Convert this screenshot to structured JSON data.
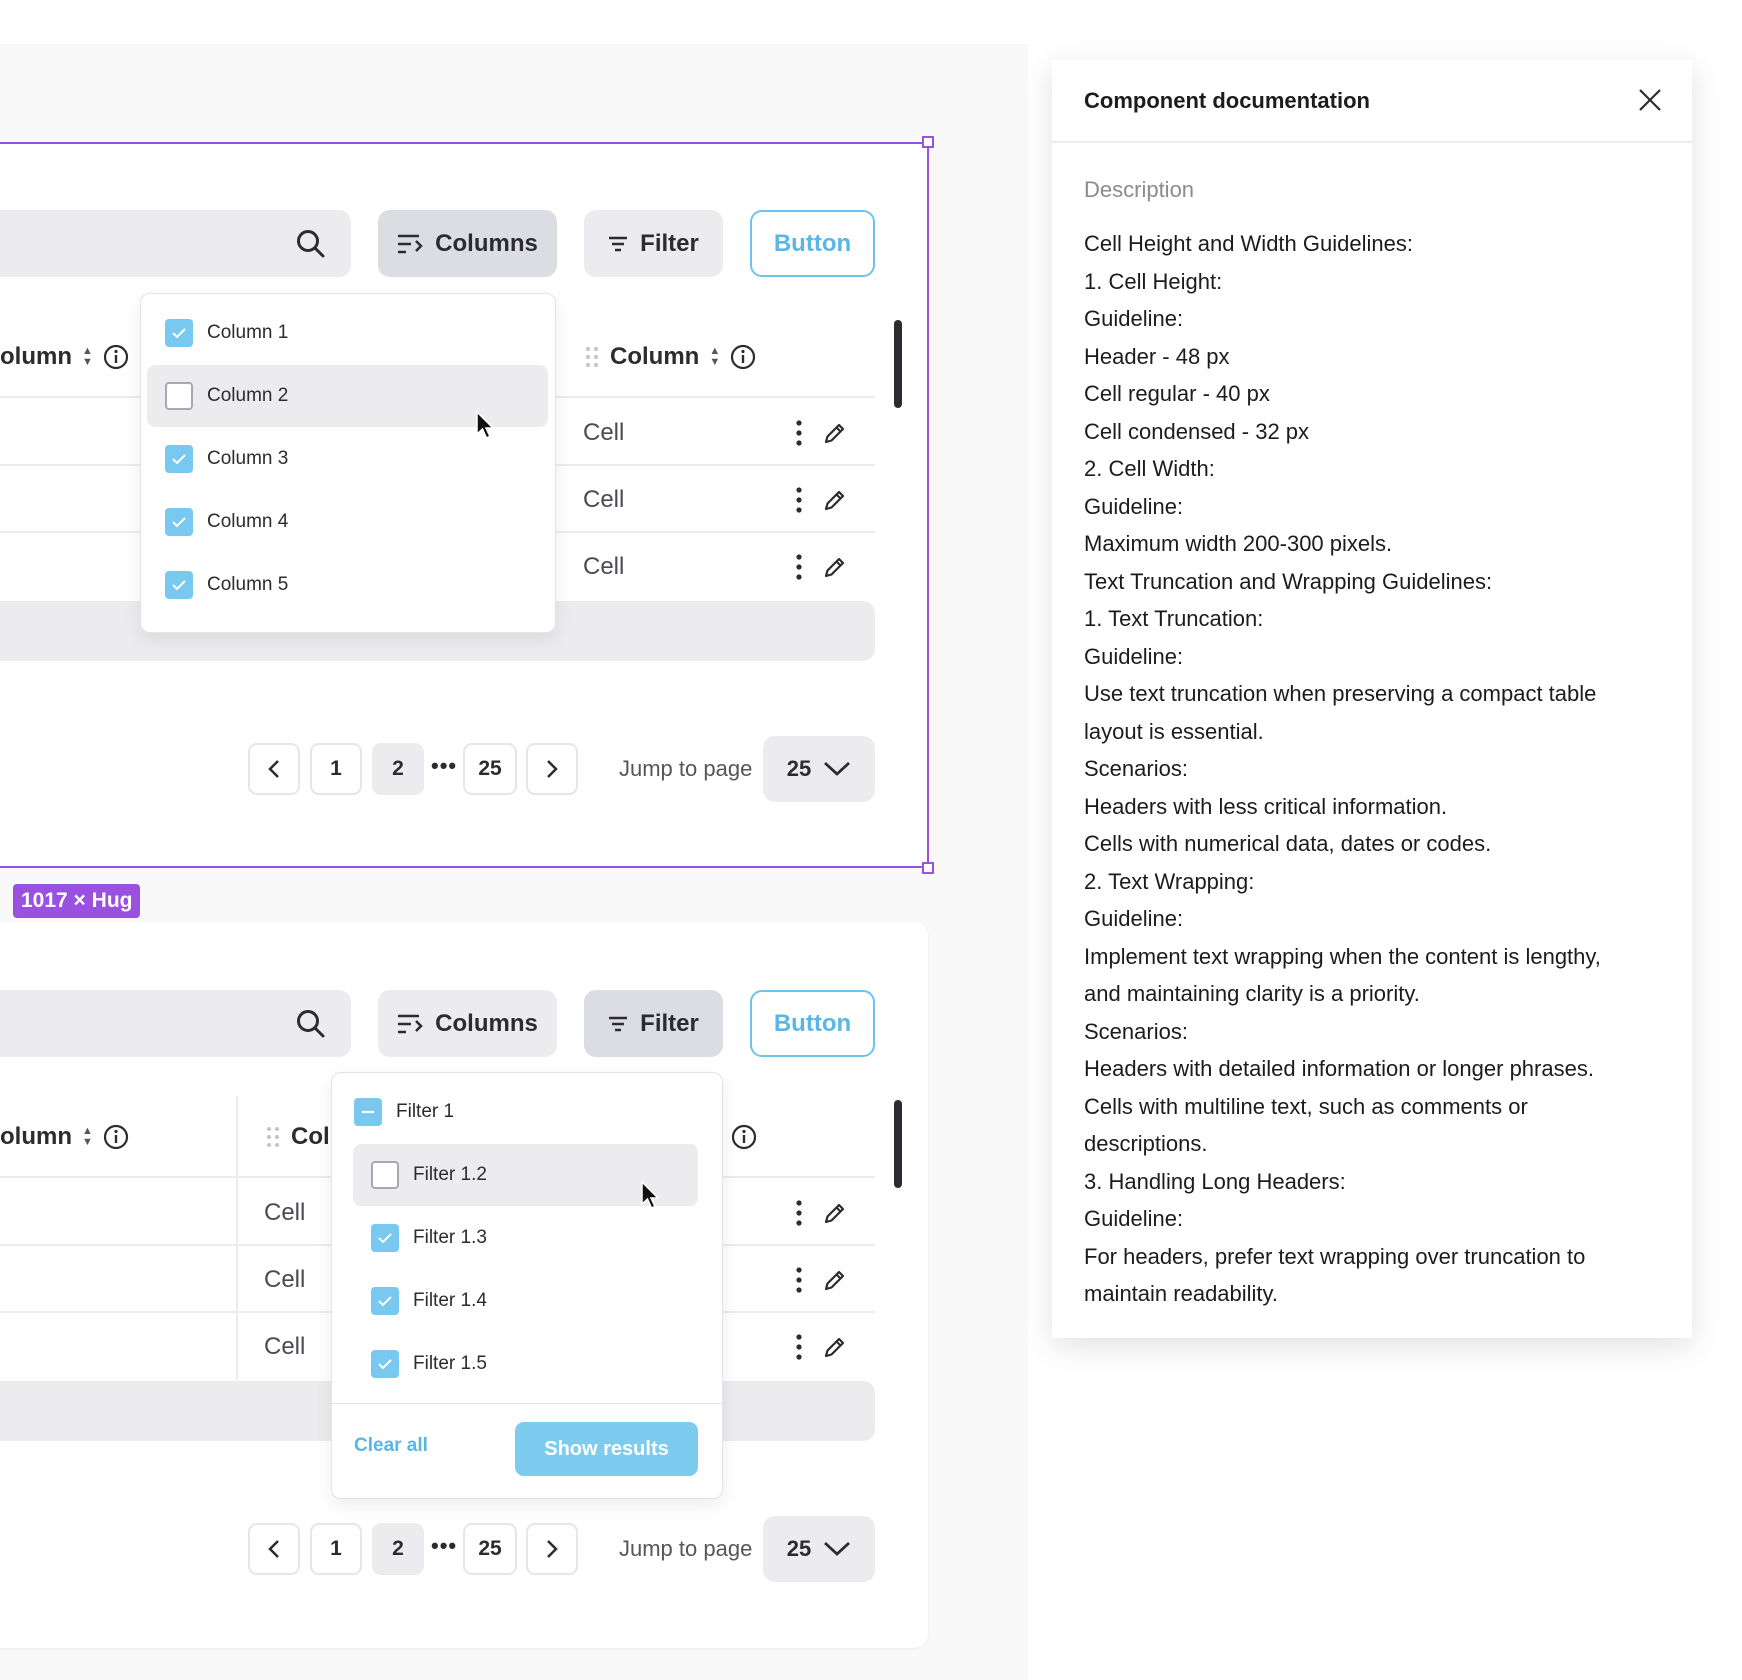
{
  "toolbar": {
    "columns_label": "Columns",
    "filter_label": "Filter",
    "button_label": "Button"
  },
  "table": {
    "header_column_label": "Column",
    "header_column_truncated": "olumn",
    "header_col_short": "Col",
    "cell_label": "Cell"
  },
  "columns_dropdown": {
    "items": [
      {
        "label": "Column 1",
        "checked": true
      },
      {
        "label": "Column 2",
        "checked": false
      },
      {
        "label": "Column 3",
        "checked": true
      },
      {
        "label": "Column 4",
        "checked": true
      },
      {
        "label": "Column 5",
        "checked": true
      }
    ]
  },
  "filter_dropdown": {
    "parent": {
      "label": "Filter 1",
      "state": "mixed"
    },
    "items": [
      {
        "label": "Filter 1.2",
        "checked": false
      },
      {
        "label": "Filter 1.3",
        "checked": true
      },
      {
        "label": "Filter 1.4",
        "checked": true
      },
      {
        "label": "Filter 1.5",
        "checked": true
      }
    ],
    "clear_label": "Clear all",
    "show_results_label": "Show results"
  },
  "pagination": {
    "pages": [
      "1",
      "2",
      "25"
    ],
    "current": "2",
    "ellipsis": "•••",
    "jump_label": "Jump to page",
    "jump_value": "25"
  },
  "selection": {
    "size_label": "1017 × Hug"
  },
  "doc_panel": {
    "title": "Component documentation",
    "section_title": "Description",
    "lines": [
      "Cell Height and Width Guidelines:",
      "1. Cell Height:",
      "Guideline:",
      "Header - 48 px",
      "Cell regular - 40 px",
      "Cell condensed - 32 px",
      "2. Cell Width:",
      "Guideline:",
      "Maximum width 200-300 pixels.",
      "Text Truncation and Wrapping Guidelines:",
      "1. Text Truncation:",
      "Guideline:",
      "Use text truncation when preserving a compact table",
      "layout is essential.",
      "Scenarios:",
      "Headers with less critical information.",
      "Cells with numerical data, dates or codes.",
      "2. Text Wrapping:",
      "Guideline:",
      "Implement text wrapping when the content is lengthy,",
      "and maintaining clarity is a priority.",
      "Scenarios:",
      "Headers with detailed information or longer phrases.",
      "Cells with multiline text, such as comments or",
      "descriptions.",
      "3. Handling Long Headers:",
      "Guideline:",
      "For headers, prefer text wrapping over truncation to",
      "maintain readability."
    ]
  },
  "colors": {
    "accent": "#78c8f0",
    "selection": "#9b51e0",
    "surface": "#ececef"
  }
}
